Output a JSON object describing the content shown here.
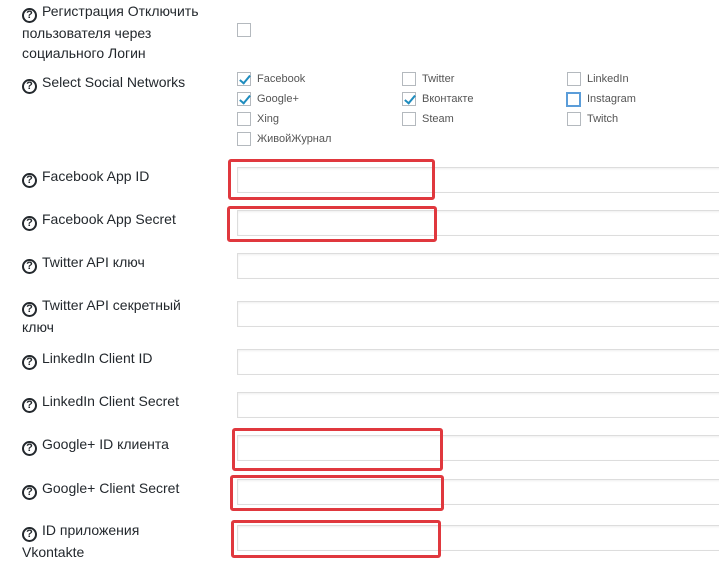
{
  "fields": [
    {
      "label": "Регистрация Отключить пользователя через социального Логин"
    },
    {
      "label": "Select Social Networks"
    },
    {
      "label": "Facebook App ID",
      "value": ""
    },
    {
      "label": "Facebook App Secret",
      "value": ""
    },
    {
      "label": "Twitter API ключ",
      "value": ""
    },
    {
      "label": "Twitter API секретный ключ",
      "value": ""
    },
    {
      "label": "LinkedIn Client ID",
      "value": ""
    },
    {
      "label": "LinkedIn Client Secret",
      "value": ""
    },
    {
      "label": "Google+ ID клиента",
      "value": ""
    },
    {
      "label": "Google+ Client Secret",
      "value": ""
    },
    {
      "label": "ID приложения Vkontakte",
      "value": ""
    }
  ],
  "networks": [
    {
      "label": "Facebook",
      "checked": true
    },
    {
      "label": "Twitter",
      "checked": false
    },
    {
      "label": "LinkedIn",
      "checked": false
    },
    {
      "label": "Google+",
      "checked": true
    },
    {
      "label": "Вконтакте",
      "checked": true
    },
    {
      "label": "Instagram",
      "checked": false
    },
    {
      "label": "Xing",
      "checked": false
    },
    {
      "label": "Steam",
      "checked": false
    },
    {
      "label": "Twitch",
      "checked": false
    },
    {
      "label": "ЖивойЖурнал",
      "checked": false
    }
  ],
  "disable_registration_checked": false,
  "highlight_color": "#e0383e",
  "check_color": "#1e8cbe"
}
